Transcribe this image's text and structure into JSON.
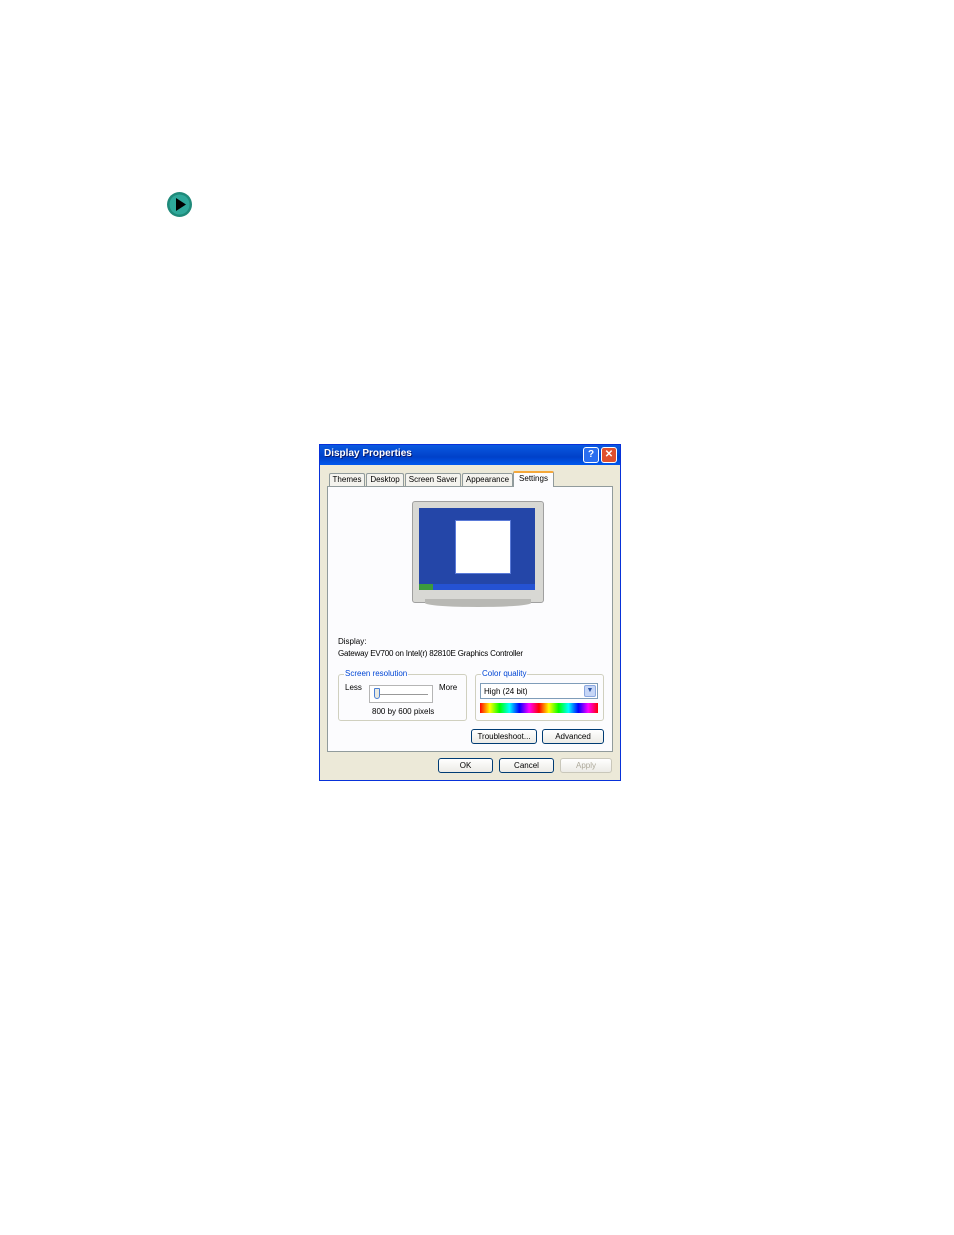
{
  "dialog": {
    "title": "Display Properties",
    "help_glyph": "?",
    "close_glyph": "✕",
    "tabs": [
      {
        "label": "Themes",
        "active": false
      },
      {
        "label": "Desktop",
        "active": false
      },
      {
        "label": "Screen Saver",
        "active": false
      },
      {
        "label": "Appearance",
        "active": false
      },
      {
        "label": "Settings",
        "active": true
      }
    ],
    "display_label": "Display:",
    "display_value": "Gateway EV700 on Intel(r) 82810E Graphics Controller",
    "resolution": {
      "title": "Screen resolution",
      "less": "Less",
      "more": "More",
      "value_text": "800 by 600 pixels",
      "slider_level": 0
    },
    "color_quality": {
      "title": "Color quality",
      "selected": "High (24 bit)"
    },
    "buttons": {
      "troubleshoot": "Troubleshoot...",
      "advanced": "Advanced",
      "ok": "OK",
      "cancel": "Cancel",
      "apply": "Apply"
    }
  },
  "icons": {
    "bullet": "arrow-right-icon",
    "dropdown": "chevron-down-icon"
  },
  "colors": {
    "titlebar": "#0058ee",
    "active_tab_accent": "#f5a83a",
    "bullet": "#1f8a7a"
  }
}
